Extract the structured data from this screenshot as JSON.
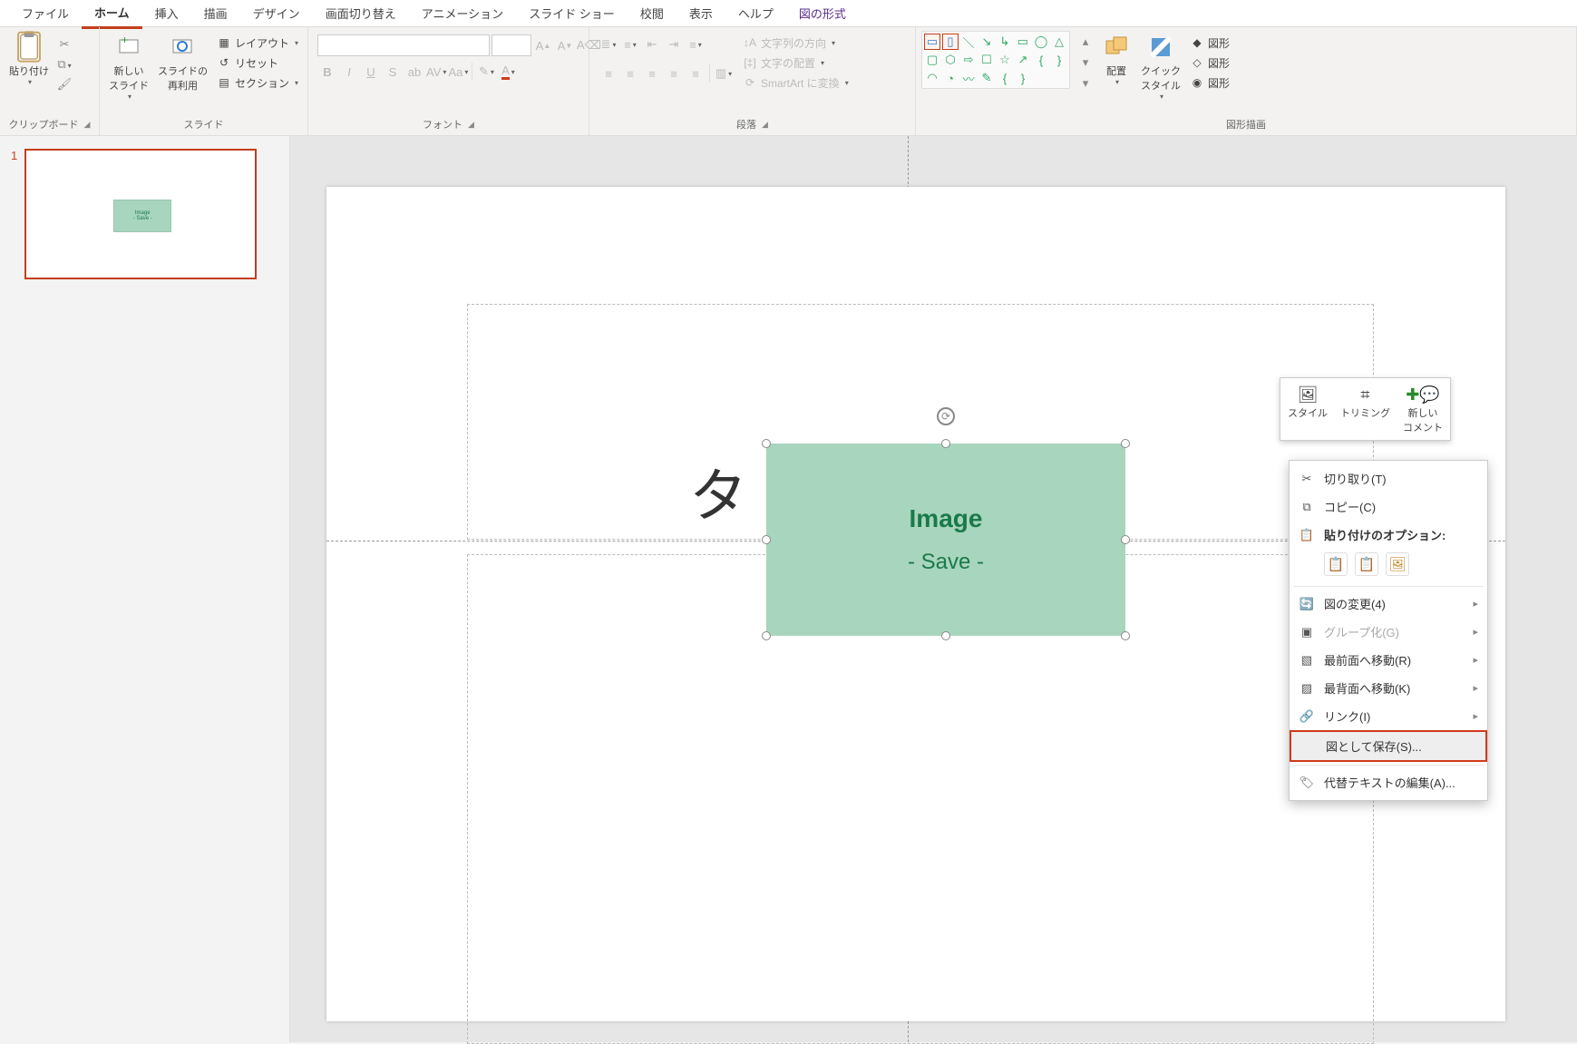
{
  "tabs": {
    "file": "ファイル",
    "home": "ホーム",
    "insert": "挿入",
    "draw": "描画",
    "design": "デザイン",
    "transitions": "画面切り替え",
    "animations": "アニメーション",
    "slideshow": "スライド ショー",
    "review": "校閲",
    "view": "表示",
    "help": "ヘルプ",
    "pictureformat": "図の形式"
  },
  "ribbon": {
    "clipboard": {
      "paste": "貼り付け",
      "label": "クリップボード"
    },
    "slides": {
      "new": "新しい\nスライド",
      "reuse": "スライドの\n再利用",
      "layout": "レイアウト",
      "reset": "リセット",
      "section": "セクション",
      "label": "スライド"
    },
    "font": {
      "label": "フォント"
    },
    "paragraph": {
      "textdir": "文字列の方向",
      "align": "文字の配置",
      "smartart": "SmartArt に変換",
      "label": "段落"
    },
    "drawing": {
      "arrange": "配置",
      "quickstyle": "クイック\nスタイル",
      "shapefill": "図形",
      "shapeoutline": "図形",
      "shapeeffects": "図形",
      "label": "図形描画"
    }
  },
  "thumb": {
    "index": "1",
    "img_t1": "Image",
    "img_t2": "- Save -"
  },
  "slide": {
    "title_placeholder": "タ",
    "img_t1": "Image",
    "img_t2": "- Save -"
  },
  "mini": {
    "style": "スタイル",
    "crop": "トリミング",
    "comment": "新しい\nコメント"
  },
  "menu": {
    "cut": "切り取り(T)",
    "copy": "コピー(C)",
    "paste_label": "貼り付けのオプション:",
    "change_pic": "図の変更(4)",
    "group": "グループ化(G)",
    "bring_front": "最前面へ移動(R)",
    "send_back": "最背面へ移動(K)",
    "link": "リンク(I)",
    "save_as_pic": "図として保存(S)...",
    "alt_text": "代替テキストの編集(A)..."
  }
}
